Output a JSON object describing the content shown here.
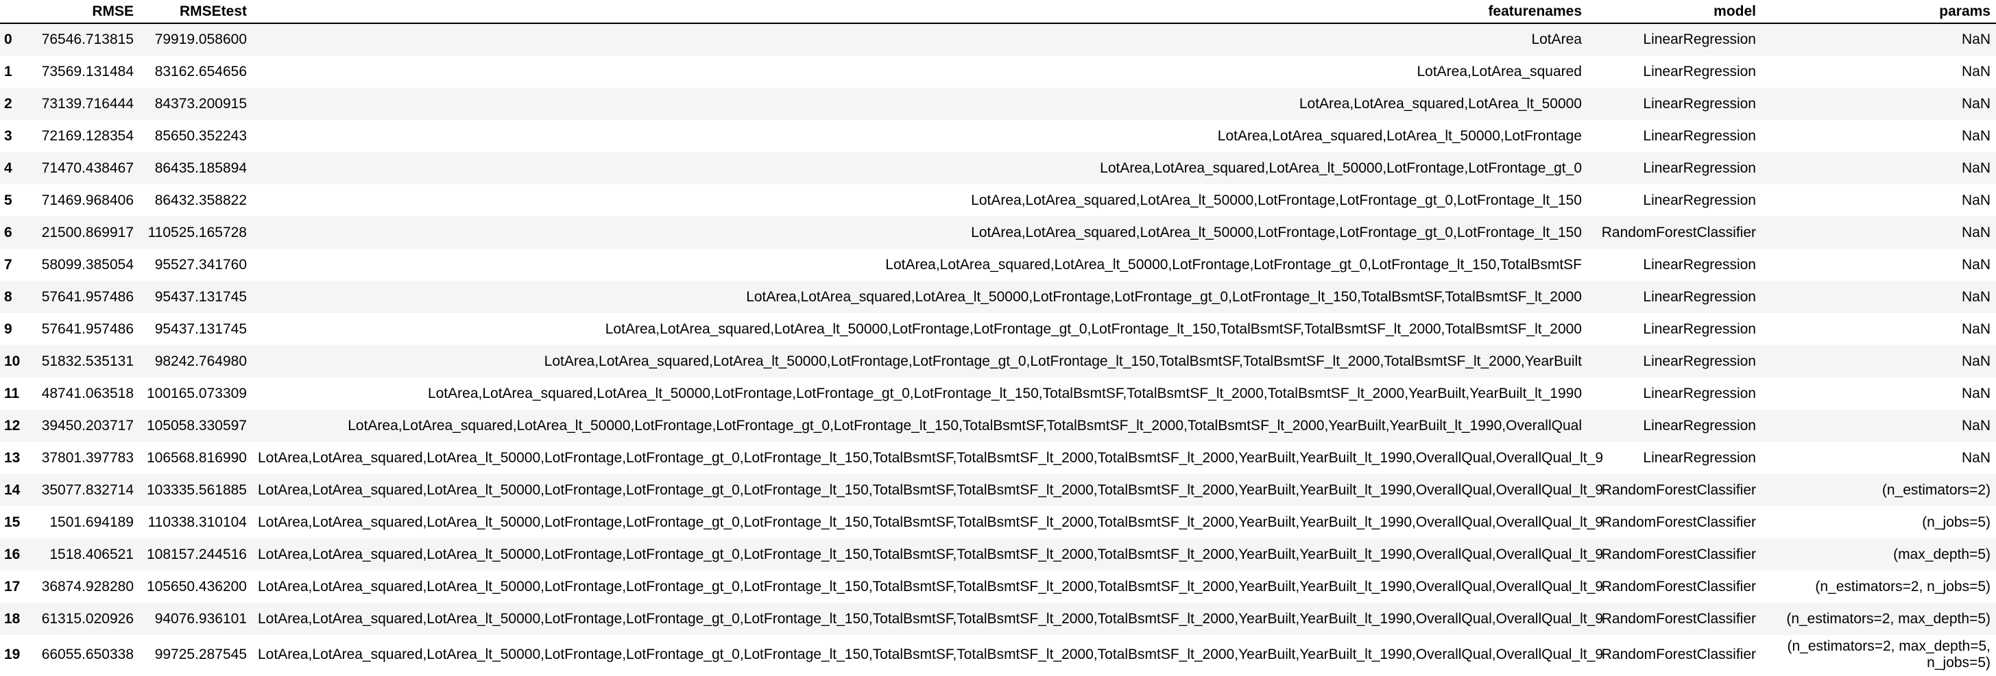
{
  "table": {
    "columns": [
      "",
      "RMSE",
      "RMSEtest",
      "featurenames",
      "model",
      "params"
    ],
    "rows": [
      {
        "index": "0",
        "RMSE": "76546.713815",
        "RMSEtest": "79919.058600",
        "featurenames": "LotArea",
        "model": "LinearRegression",
        "params": "NaN"
      },
      {
        "index": "1",
        "RMSE": "73569.131484",
        "RMSEtest": "83162.654656",
        "featurenames": "LotArea,LotArea_squared",
        "model": "LinearRegression",
        "params": "NaN"
      },
      {
        "index": "2",
        "RMSE": "73139.716444",
        "RMSEtest": "84373.200915",
        "featurenames": "LotArea,LotArea_squared,LotArea_lt_50000",
        "model": "LinearRegression",
        "params": "NaN"
      },
      {
        "index": "3",
        "RMSE": "72169.128354",
        "RMSEtest": "85650.352243",
        "featurenames": "LotArea,LotArea_squared,LotArea_lt_50000,LotFrontage",
        "model": "LinearRegression",
        "params": "NaN"
      },
      {
        "index": "4",
        "RMSE": "71470.438467",
        "RMSEtest": "86435.185894",
        "featurenames": "LotArea,LotArea_squared,LotArea_lt_50000,LotFrontage,LotFrontage_gt_0",
        "model": "LinearRegression",
        "params": "NaN"
      },
      {
        "index": "5",
        "RMSE": "71469.968406",
        "RMSEtest": "86432.358822",
        "featurenames": "LotArea,LotArea_squared,LotArea_lt_50000,LotFrontage,LotFrontage_gt_0,LotFrontage_lt_150",
        "model": "LinearRegression",
        "params": "NaN"
      },
      {
        "index": "6",
        "RMSE": "21500.869917",
        "RMSEtest": "110525.165728",
        "featurenames": "LotArea,LotArea_squared,LotArea_lt_50000,LotFrontage,LotFrontage_gt_0,LotFrontage_lt_150",
        "model": "RandomForestClassifier",
        "params": "NaN"
      },
      {
        "index": "7",
        "RMSE": "58099.385054",
        "RMSEtest": "95527.341760",
        "featurenames": "LotArea,LotArea_squared,LotArea_lt_50000,LotFrontage,LotFrontage_gt_0,LotFrontage_lt_150,TotalBsmtSF",
        "model": "LinearRegression",
        "params": "NaN"
      },
      {
        "index": "8",
        "RMSE": "57641.957486",
        "RMSEtest": "95437.131745",
        "featurenames": "LotArea,LotArea_squared,LotArea_lt_50000,LotFrontage,LotFrontage_gt_0,LotFrontage_lt_150,TotalBsmtSF,TotalBsmtSF_lt_2000",
        "model": "LinearRegression",
        "params": "NaN"
      },
      {
        "index": "9",
        "RMSE": "57641.957486",
        "RMSEtest": "95437.131745",
        "featurenames": "LotArea,LotArea_squared,LotArea_lt_50000,LotFrontage,LotFrontage_gt_0,LotFrontage_lt_150,TotalBsmtSF,TotalBsmtSF_lt_2000,TotalBsmtSF_lt_2000",
        "model": "LinearRegression",
        "params": "NaN"
      },
      {
        "index": "10",
        "RMSE": "51832.535131",
        "RMSEtest": "98242.764980",
        "featurenames": "LotArea,LotArea_squared,LotArea_lt_50000,LotFrontage,LotFrontage_gt_0,LotFrontage_lt_150,TotalBsmtSF,TotalBsmtSF_lt_2000,TotalBsmtSF_lt_2000,YearBuilt",
        "model": "LinearRegression",
        "params": "NaN"
      },
      {
        "index": "11",
        "RMSE": "48741.063518",
        "RMSEtest": "100165.073309",
        "featurenames": "LotArea,LotArea_squared,LotArea_lt_50000,LotFrontage,LotFrontage_gt_0,LotFrontage_lt_150,TotalBsmtSF,TotalBsmtSF_lt_2000,TotalBsmtSF_lt_2000,YearBuilt,YearBuilt_lt_1990",
        "model": "LinearRegression",
        "params": "NaN"
      },
      {
        "index": "12",
        "RMSE": "39450.203717",
        "RMSEtest": "105058.330597",
        "featurenames": "LotArea,LotArea_squared,LotArea_lt_50000,LotFrontage,LotFrontage_gt_0,LotFrontage_lt_150,TotalBsmtSF,TotalBsmtSF_lt_2000,TotalBsmtSF_lt_2000,YearBuilt,YearBuilt_lt_1990,OverallQual",
        "model": "LinearRegression",
        "params": "NaN"
      },
      {
        "index": "13",
        "RMSE": "37801.397783",
        "RMSEtest": "106568.816990",
        "featurenames": "LotArea,LotArea_squared,LotArea_lt_50000,LotFrontage,LotFrontage_gt_0,LotFrontage_lt_150,TotalBsmtSF,TotalBsmtSF_lt_2000,TotalBsmtSF_lt_2000,YearBuilt,YearBuilt_lt_1990,OverallQual,OverallQual_lt_9",
        "model": "LinearRegression",
        "params": "NaN"
      },
      {
        "index": "14",
        "RMSE": "35077.832714",
        "RMSEtest": "103335.561885",
        "featurenames": "LotArea,LotArea_squared,LotArea_lt_50000,LotFrontage,LotFrontage_gt_0,LotFrontage_lt_150,TotalBsmtSF,TotalBsmtSF_lt_2000,TotalBsmtSF_lt_2000,YearBuilt,YearBuilt_lt_1990,OverallQual,OverallQual_lt_9",
        "model": "RandomForestClassifier",
        "params": "(n_estimators=2)"
      },
      {
        "index": "15",
        "RMSE": "1501.694189",
        "RMSEtest": "110338.310104",
        "featurenames": "LotArea,LotArea_squared,LotArea_lt_50000,LotFrontage,LotFrontage_gt_0,LotFrontage_lt_150,TotalBsmtSF,TotalBsmtSF_lt_2000,TotalBsmtSF_lt_2000,YearBuilt,YearBuilt_lt_1990,OverallQual,OverallQual_lt_9",
        "model": "RandomForestClassifier",
        "params": "(n_jobs=5)"
      },
      {
        "index": "16",
        "RMSE": "1518.406521",
        "RMSEtest": "108157.244516",
        "featurenames": "LotArea,LotArea_squared,LotArea_lt_50000,LotFrontage,LotFrontage_gt_0,LotFrontage_lt_150,TotalBsmtSF,TotalBsmtSF_lt_2000,TotalBsmtSF_lt_2000,YearBuilt,YearBuilt_lt_1990,OverallQual,OverallQual_lt_9",
        "model": "RandomForestClassifier",
        "params": "(max_depth=5)"
      },
      {
        "index": "17",
        "RMSE": "36874.928280",
        "RMSEtest": "105650.436200",
        "featurenames": "LotArea,LotArea_squared,LotArea_lt_50000,LotFrontage,LotFrontage_gt_0,LotFrontage_lt_150,TotalBsmtSF,TotalBsmtSF_lt_2000,TotalBsmtSF_lt_2000,YearBuilt,YearBuilt_lt_1990,OverallQual,OverallQual_lt_9",
        "model": "RandomForestClassifier",
        "params": "(n_estimators=2, n_jobs=5)"
      },
      {
        "index": "18",
        "RMSE": "61315.020926",
        "RMSEtest": "94076.936101",
        "featurenames": "LotArea,LotArea_squared,LotArea_lt_50000,LotFrontage,LotFrontage_gt_0,LotFrontage_lt_150,TotalBsmtSF,TotalBsmtSF_lt_2000,TotalBsmtSF_lt_2000,YearBuilt,YearBuilt_lt_1990,OverallQual,OverallQual_lt_9",
        "model": "RandomForestClassifier",
        "params": "(n_estimators=2, max_depth=5)"
      },
      {
        "index": "19",
        "RMSE": "66055.650338",
        "RMSEtest": "99725.287545",
        "featurenames": "LotArea,LotArea_squared,LotArea_lt_50000,LotFrontage,LotFrontage_gt_0,LotFrontage_lt_150,TotalBsmtSF,TotalBsmtSF_lt_2000,TotalBsmtSF_lt_2000,YearBuilt,YearBuilt_lt_1990,OverallQual,OverallQual_lt_9",
        "model": "RandomForestClassifier",
        "params": "(n_estimators=2, max_depth=5, n_jobs=5)"
      }
    ]
  }
}
